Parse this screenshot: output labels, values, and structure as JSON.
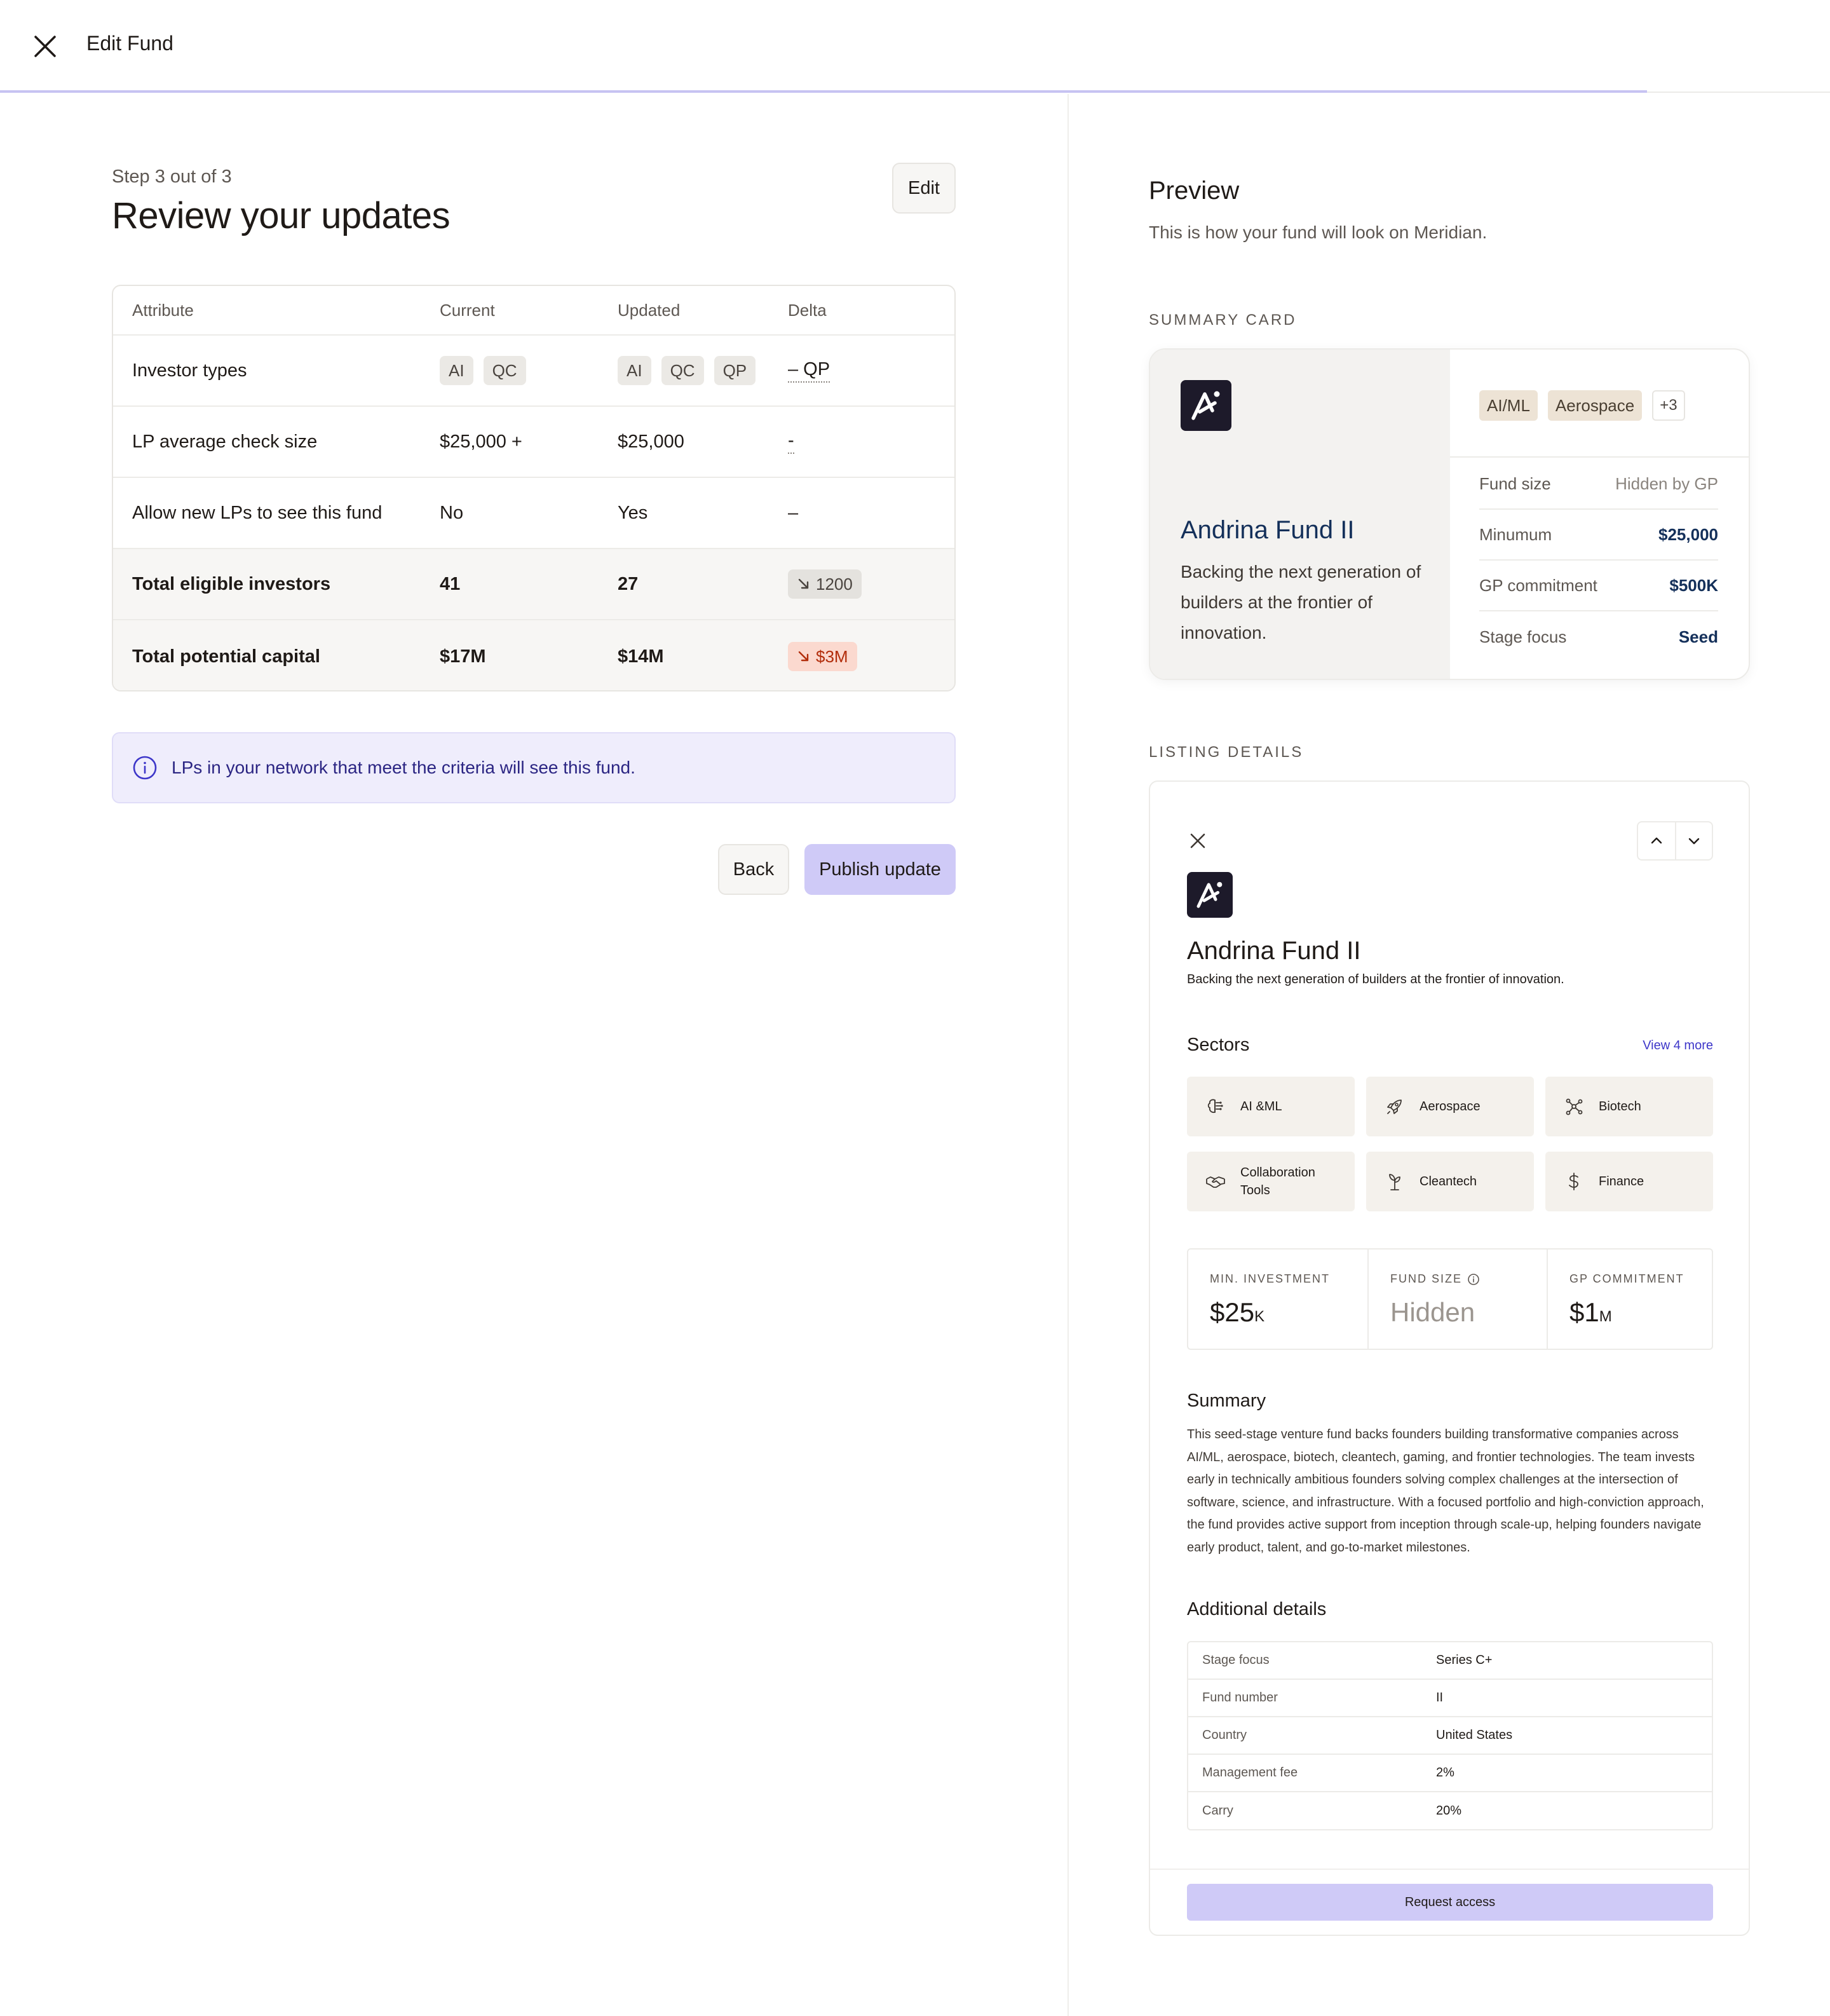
{
  "header": {
    "title": "Edit Fund",
    "close_icon": "close-icon",
    "progress_percent": 90
  },
  "left": {
    "step": "Step 3 out of 3",
    "title": "Review your updates",
    "edit_label": "Edit",
    "table": {
      "headers": [
        "Attribute",
        "Current",
        "Updated",
        "Delta"
      ],
      "rows": [
        {
          "attribute": "Investor types",
          "current_chips": [
            "AI",
            "QC"
          ],
          "updated_chips": [
            "AI",
            "QC",
            "QP"
          ],
          "delta": "– QP"
        },
        {
          "attribute": "LP average check size",
          "current": "$25,000 +",
          "updated": "$25,000",
          "delta": "-"
        },
        {
          "attribute": "Allow new LPs to see this fund",
          "current": "No",
          "updated": "Yes",
          "delta": "–"
        },
        {
          "attribute": "Total eligible investors",
          "current": "41",
          "updated": "27",
          "delta": "1200"
        },
        {
          "attribute": "Total potential capital",
          "current": "$17M",
          "updated": "$14M",
          "delta": "$3M"
        }
      ]
    },
    "info_text": "LPs in your network that meet the criteria will see this fund.",
    "back_label": "Back",
    "publish_label": "Publish update"
  },
  "preview": {
    "title": "Preview",
    "subtitle": "This is how your fund will look on Meridian.",
    "summary_caption": "SUMMARY CARD",
    "listing_caption": "LISTING DETAILS",
    "summary_card": {
      "fund_name": "Andrina Fund II",
      "description": "Backing the next generation of builders at the frontier of innovation.",
      "tags": [
        "AI/ML",
        "Aerospace"
      ],
      "more_tags": "+3",
      "rows": [
        {
          "label": "Fund size",
          "value": "Hidden by GP"
        },
        {
          "label": "Minumum",
          "value": "$25,000"
        },
        {
          "label": "GP commitment",
          "value": "$500K"
        },
        {
          "label": "Stage focus",
          "value": "Seed"
        }
      ]
    },
    "listing": {
      "fund_name": "Andrina Fund II",
      "tagline": "Backing the next generation of builders at the frontier of innovation.",
      "sectors_title": "Sectors",
      "view_more": "View 4 more",
      "sectors": [
        {
          "label": "AI &ML",
          "icon": "brain-icon"
        },
        {
          "label": "Aerospace",
          "icon": "rocket-icon"
        },
        {
          "label": "Biotech",
          "icon": "molecule-icon"
        },
        {
          "label": "Collaboration Tools",
          "icon": "handshake-icon"
        },
        {
          "label": "Cleantech",
          "icon": "sprout-icon"
        },
        {
          "label": "Finance",
          "icon": "dollar-icon"
        }
      ],
      "stats": [
        {
          "caption": "MIN. INVESTMENT",
          "value": "$25",
          "unit": "K"
        },
        {
          "caption": "FUND SIZE",
          "value": "Hidden",
          "unit": ""
        },
        {
          "caption": "GP COMMITMENT",
          "value": "$1",
          "unit": "M"
        }
      ],
      "summary_title": "Summary",
      "summary_text": "This seed-stage venture fund backs founders building transformative companies across AI/ML, aerospace, biotech, cleantech, gaming, and frontier technologies. The team invests early in technically ambitious founders solving complex challenges at the intersection of software, science, and infrastructure. With a focused portfolio and high-conviction approach, the fund provides active support from inception through scale-up, helping founders navigate early product, talent, and go-to-market milestones.",
      "additional_title": "Additional details",
      "details": [
        {
          "label": "Stage focus",
          "value": "Series C+"
        },
        {
          "label": "Fund number",
          "value": "II"
        },
        {
          "label": "Country",
          "value": "United States"
        },
        {
          "label": "Management fee",
          "value": "2%"
        },
        {
          "label": "Carry",
          "value": "20%"
        }
      ],
      "request_label": "Request access"
    }
  },
  "colors": {
    "accent": "#cfcaf7",
    "info_bg": "#efedfc",
    "delta_red": "#b22d0b",
    "navy": "#14305a"
  }
}
